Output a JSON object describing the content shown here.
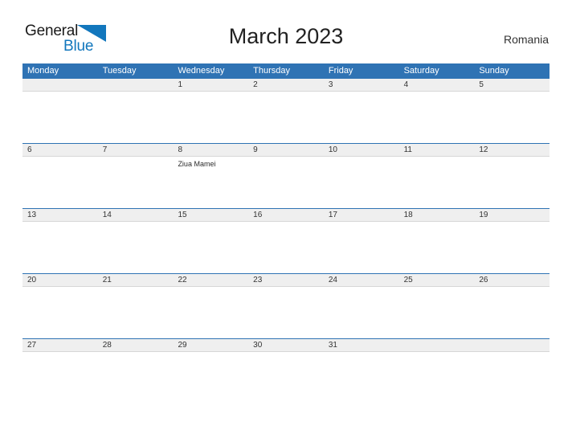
{
  "brand": {
    "word_one": "General",
    "word_two": "Blue",
    "flag_icon": "flag-triangle-icon",
    "accent_color": "#1277bd"
  },
  "header": {
    "title": "March 2023",
    "country": "Romania",
    "header_bg_color": "#2f73b4",
    "band_bg_color": "#efefef"
  },
  "calendar": {
    "weekdays": [
      "Monday",
      "Tuesday",
      "Wednesday",
      "Thursday",
      "Friday",
      "Saturday",
      "Sunday"
    ],
    "weeks": [
      {
        "days": [
          {
            "num": "",
            "events": []
          },
          {
            "num": "",
            "events": []
          },
          {
            "num": "1",
            "events": []
          },
          {
            "num": "2",
            "events": []
          },
          {
            "num": "3",
            "events": []
          },
          {
            "num": "4",
            "events": []
          },
          {
            "num": "5",
            "events": []
          }
        ]
      },
      {
        "days": [
          {
            "num": "6",
            "events": []
          },
          {
            "num": "7",
            "events": []
          },
          {
            "num": "8",
            "events": [
              "Ziua Mamei"
            ]
          },
          {
            "num": "9",
            "events": []
          },
          {
            "num": "10",
            "events": []
          },
          {
            "num": "11",
            "events": []
          },
          {
            "num": "12",
            "events": []
          }
        ]
      },
      {
        "days": [
          {
            "num": "13",
            "events": []
          },
          {
            "num": "14",
            "events": []
          },
          {
            "num": "15",
            "events": []
          },
          {
            "num": "16",
            "events": []
          },
          {
            "num": "17",
            "events": []
          },
          {
            "num": "18",
            "events": []
          },
          {
            "num": "19",
            "events": []
          }
        ]
      },
      {
        "days": [
          {
            "num": "20",
            "events": []
          },
          {
            "num": "21",
            "events": []
          },
          {
            "num": "22",
            "events": []
          },
          {
            "num": "23",
            "events": []
          },
          {
            "num": "24",
            "events": []
          },
          {
            "num": "25",
            "events": []
          },
          {
            "num": "26",
            "events": []
          }
        ]
      },
      {
        "days": [
          {
            "num": "27",
            "events": []
          },
          {
            "num": "28",
            "events": []
          },
          {
            "num": "29",
            "events": []
          },
          {
            "num": "30",
            "events": []
          },
          {
            "num": "31",
            "events": []
          },
          {
            "num": "",
            "events": []
          },
          {
            "num": "",
            "events": []
          }
        ]
      }
    ]
  }
}
